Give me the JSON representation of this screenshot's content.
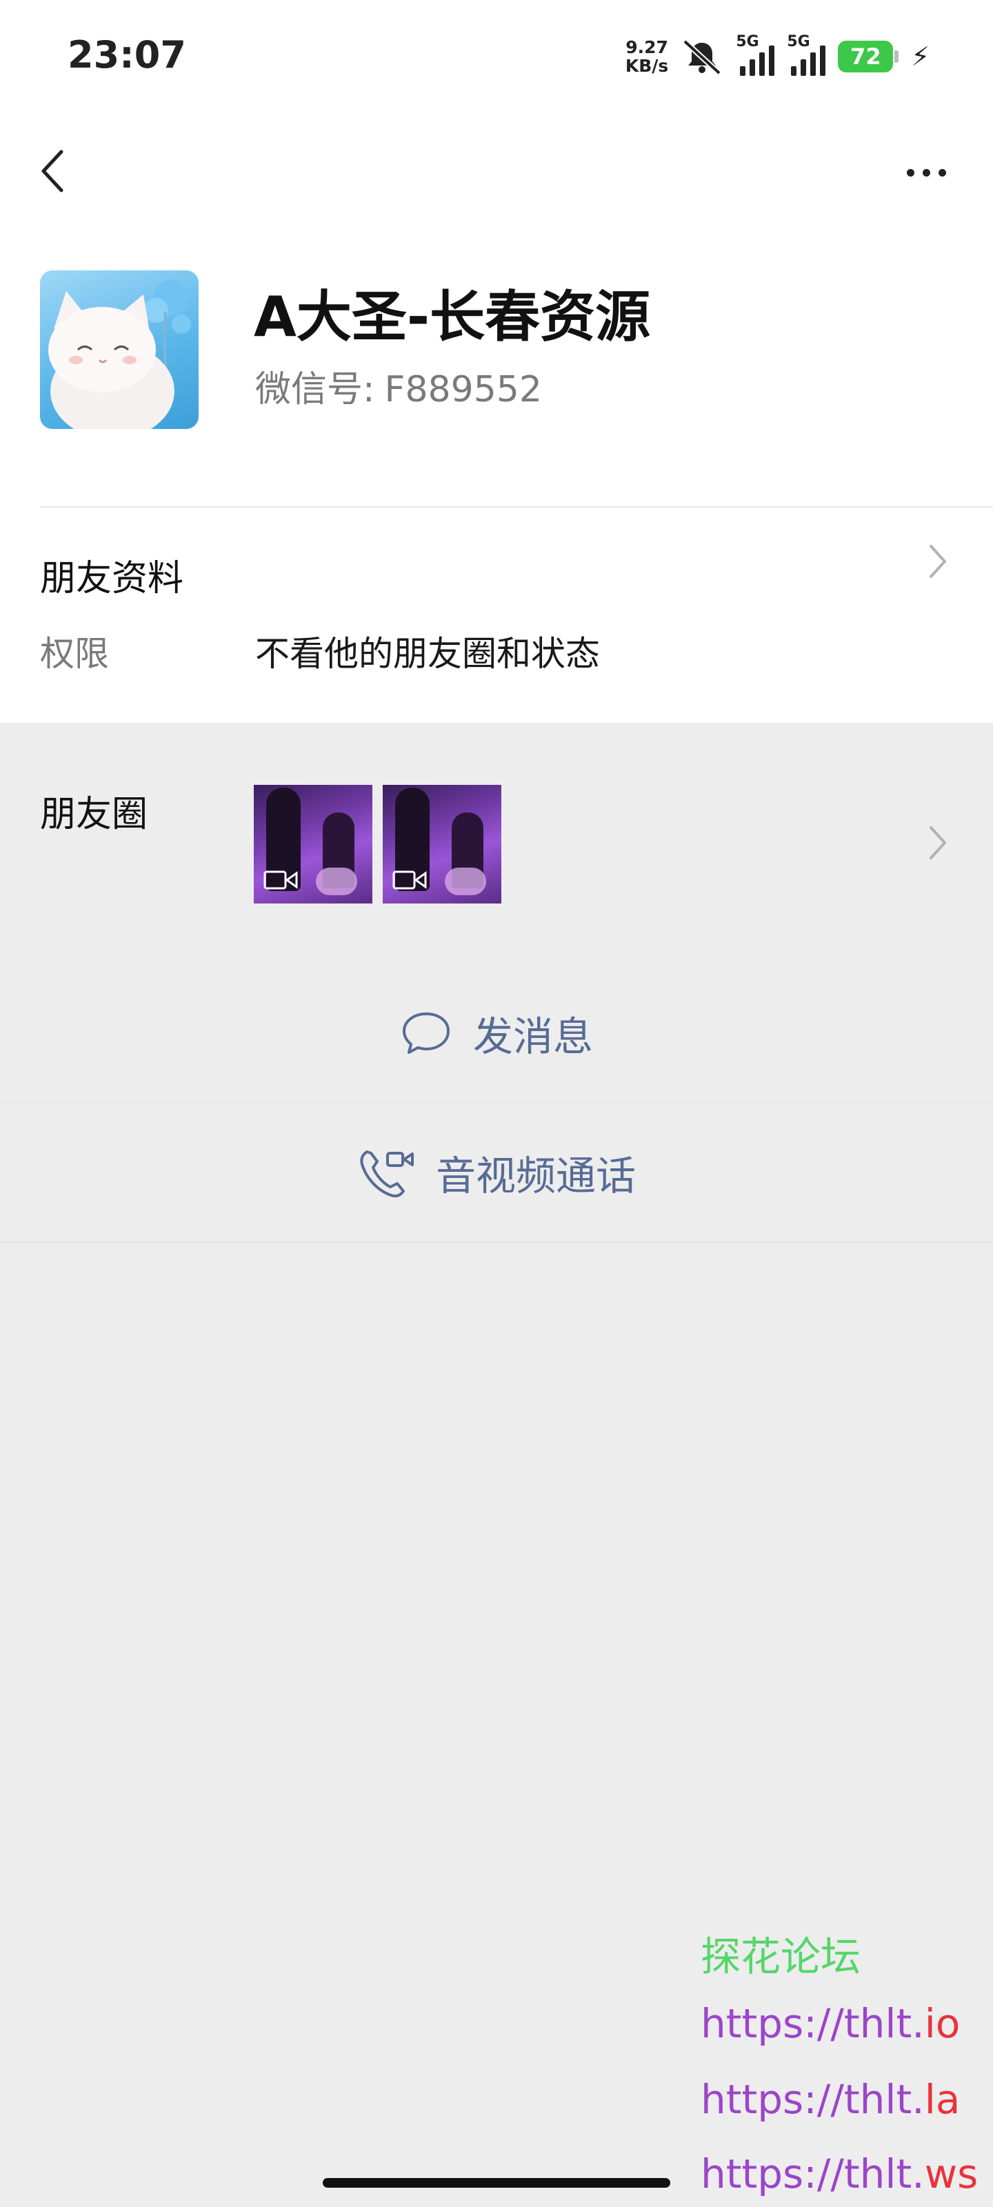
{
  "status_bar": {
    "time": "23:07",
    "net_speed_value": "9.27",
    "net_speed_unit": "KB/s",
    "signal1_label": "5G",
    "signal2_label": "5G",
    "battery": "72"
  },
  "nav": {
    "back_icon": "chevron-left-icon",
    "more_icon": "more-dots-icon"
  },
  "profile": {
    "name": "A大圣-长春资源",
    "wechat_id_label": "微信号:",
    "wechat_id": "F889552"
  },
  "friend_info": {
    "title": "朋友资料",
    "permission_label": "权限",
    "permission_value": "不看他的朋友圈和状态"
  },
  "moments": {
    "label": "朋友圈",
    "thumbnails": [
      "video",
      "video"
    ]
  },
  "actions": {
    "message_label": "发消息",
    "call_label": "音视频通话"
  },
  "watermark": {
    "title": "探花论坛",
    "urls": [
      {
        "prefix": "https://thlt.",
        "tld": "io"
      },
      {
        "prefix": "https://thlt.",
        "tld": "la"
      },
      {
        "prefix": "https://thlt.",
        "tld": "ws"
      }
    ]
  },
  "colors": {
    "link_blue": "#576b95",
    "battery_green": "#3ec84a",
    "background_gray": "#ededed",
    "watermark_green": "#55d66a",
    "watermark_purple": "#9b45c9",
    "watermark_red": "#e8333b"
  }
}
